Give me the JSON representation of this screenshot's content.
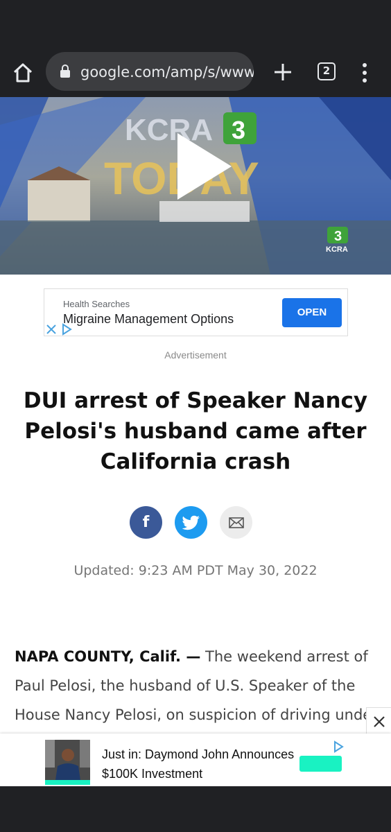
{
  "browser": {
    "url": "google.com/amp/s/www",
    "tab_count": "2"
  },
  "video": {
    "overlay_brand": "KCRA",
    "overlay_channel": "3",
    "overlay_show": "TODAY",
    "corner_logo": "KCRA"
  },
  "ad": {
    "small_text": "Health Searches",
    "title": "Migraine Management Options",
    "cta": "OPEN",
    "label": "Advertisement"
  },
  "article": {
    "headline": "DUI arrest of Speaker Nancy Pelosi's husband came after California crash",
    "updated": "Updated: 9:23 AM PDT May 30, 2022",
    "dateline": "NAPA COUNTY, Calif. —",
    "body": " The weekend arrest of Paul Pelosi, the husband of U.S. Speaker of the House Nancy Pelosi, on suspicion of driving under the"
  },
  "share": {
    "facebook": "f"
  },
  "sticky_ad": {
    "text": "Just in: Daymond John Announces $100K Investment"
  },
  "colors": {
    "chrome": "#202124",
    "facebook": "#3b5998",
    "twitter": "#1d9bf0",
    "ad_cta": "#1a73e8",
    "sticky_cta": "#19f2c2"
  }
}
